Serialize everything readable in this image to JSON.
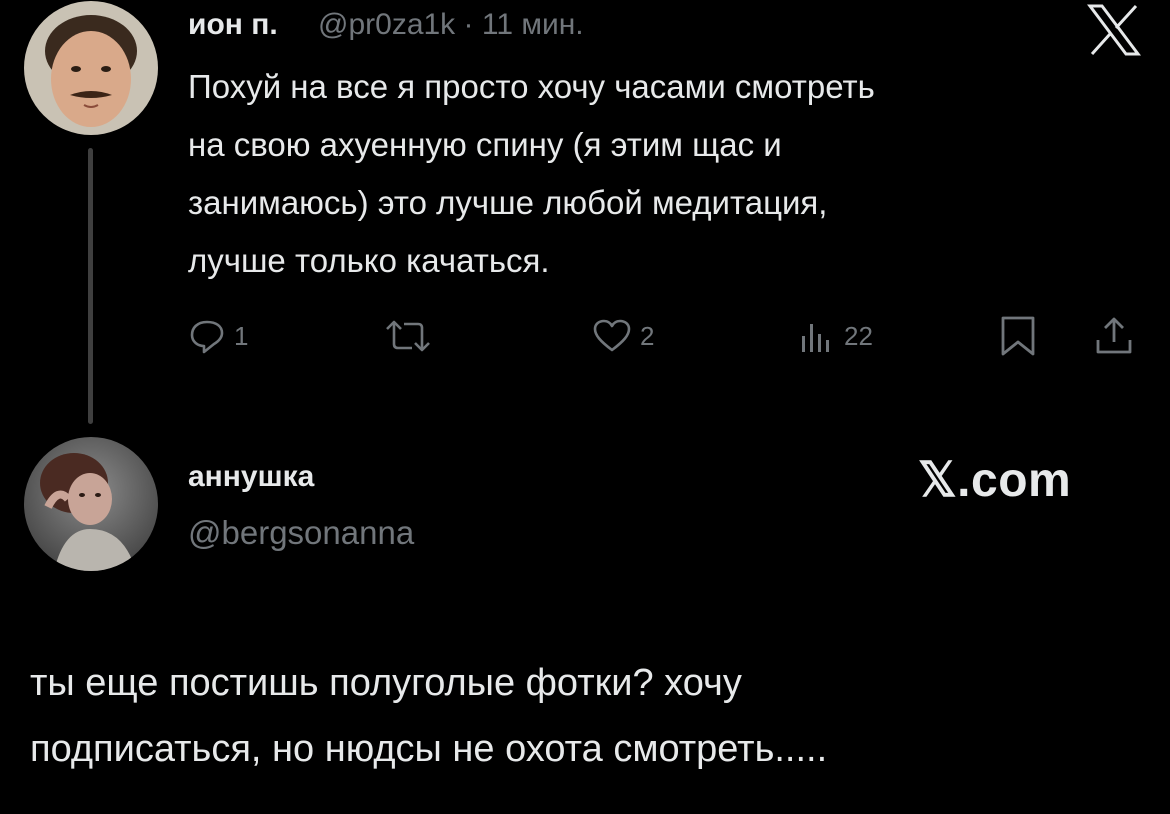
{
  "tweet": {
    "author_name": "ион п.",
    "author_handle": "@pr0za1k",
    "separator": "·",
    "time": "11 мин.",
    "text": "Похуй на все я просто хочу часами смотреть\nна свою ахуенную спину (я этим щас и\nзанимаюсь) это лучше любой медитация,\nлучше только качаться.",
    "actions": {
      "reply_count": "1",
      "like_count": "2",
      "views_count": "22"
    }
  },
  "quote_card": {
    "author_name": "аннушка",
    "author_handle": "@bergsonanna",
    "brand": "𝕏.com",
    "text": "ты еще постишь полуголые фотки? хочу\nподписаться, но нюдсы не охота смотреть....."
  },
  "icons": {
    "close": "x-logo-icon",
    "reply": "reply-icon",
    "retweet": "retweet-icon",
    "like": "heart-icon",
    "views": "views-icon",
    "bookmark": "bookmark-icon",
    "share": "share-icon"
  },
  "colors": {
    "background": "#000000",
    "text": "#e7e9ea",
    "muted": "#71767b",
    "thread_line": "#3f3f3f"
  }
}
